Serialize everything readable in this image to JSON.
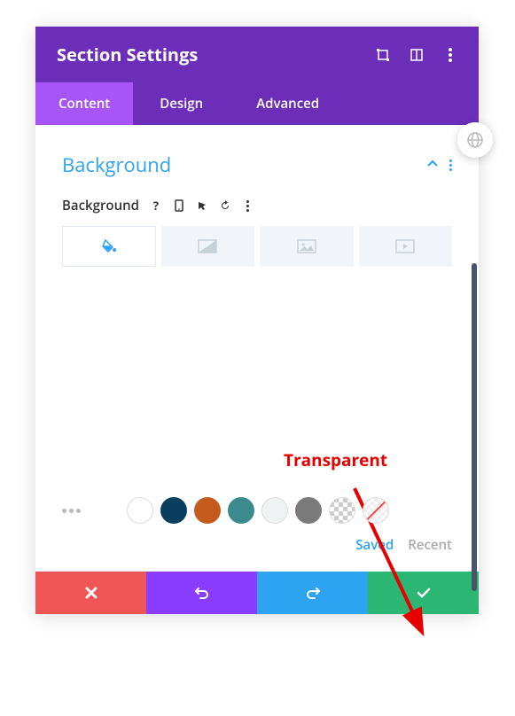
{
  "header": {
    "title": "Section Settings"
  },
  "tabs": {
    "content": "Content",
    "design": "Design",
    "advanced": "Advanced"
  },
  "section": {
    "title": "Background",
    "bg_label": "Background"
  },
  "swatches": {
    "c1": "#111111",
    "c2": "#ffffff",
    "c3": "#0a3d5f",
    "c4": "#c45a1e",
    "c5": "#3c8a8e",
    "c6": "#eef2f2",
    "c7": "#7a7a7a"
  },
  "links": {
    "saved": "Saved",
    "recent": "Recent"
  },
  "annotation": {
    "label": "Transparent"
  }
}
